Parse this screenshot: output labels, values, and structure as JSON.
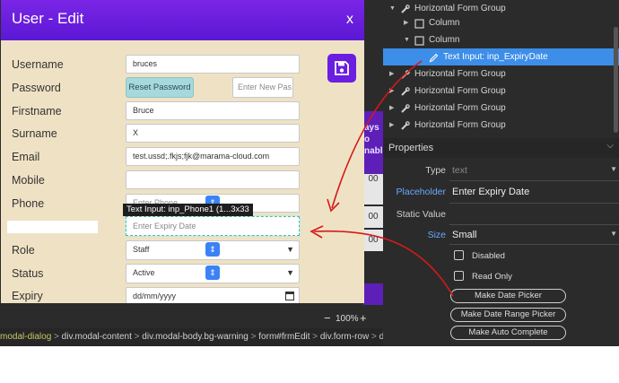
{
  "modal": {
    "title": "User - Edit",
    "close_label": "x",
    "fields": {
      "username_label": "Username",
      "username_value": "bruces",
      "password_label": "Password",
      "reset_password_label": "Reset Password",
      "new_password_placeholder": "Enter New Pas",
      "firstname_label": "Firstname",
      "firstname_value": "Bruce",
      "surname_label": "Surname",
      "surname_value": "X",
      "email_label": "Email",
      "email_value": "test.ussd;.fkjs;fjk@marama-cloud.com",
      "mobile_label": "Mobile",
      "mobile_value": "",
      "phone_label": "Phone",
      "phone_placeholder": "Enter Phone",
      "expiry_placeholder": "Enter Expiry Date",
      "role_label": "Role",
      "role_value": "Staff",
      "status_label": "Status",
      "status_value": "Active",
      "expiry_label": "Expiry",
      "expiry_date_placeholder": "dd/mm/yyyy"
    },
    "tooltip": "Text Input: inp_Phone1 (1...3x33"
  },
  "background": {
    "purple_text_1": "ays",
    "purple_text_2": "o",
    "purple_text_3": "nable",
    "gray_cell_1": "00",
    "gray_cell_2": "00",
    "gray_cell_3": "00"
  },
  "statusbar": {
    "zoom_minus": "−",
    "zoom_value": "100%",
    "zoom_plus": "+"
  },
  "breadcrumb": [
    {
      "text": "modal-dialog",
      "style": "y"
    },
    {
      "text": " > ",
      "style": "g"
    },
    {
      "text": "div.modal-content",
      "style": "w"
    },
    {
      "text": " > ",
      "style": "g"
    },
    {
      "text": "div.modal-body.bg-warning",
      "style": "w"
    },
    {
      "text": " > ",
      "style": "g"
    },
    {
      "text": "form#frmEdit",
      "style": "w"
    },
    {
      "text": " > ",
      "style": "g"
    },
    {
      "text": "div.form-row",
      "style": "w"
    },
    {
      "text": " > ",
      "style": "g"
    },
    {
      "text": "div.c",
      "style": "w"
    }
  ],
  "tree": [
    {
      "label": "Horizontal Form Group",
      "level": 0,
      "expanded": true,
      "selected": false,
      "icon": "wrench"
    },
    {
      "label": "Column",
      "level": 1,
      "expanded": false,
      "selected": false,
      "icon": "box"
    },
    {
      "label": "Column",
      "level": 1,
      "expanded": true,
      "selected": false,
      "icon": "box"
    },
    {
      "label": "Text Input: inp_ExpiryDate",
      "level": 2,
      "expanded": false,
      "selected": true,
      "icon": "pencil"
    },
    {
      "label": "Horizontal Form Group",
      "level": 0,
      "expanded": false,
      "selected": false,
      "icon": "wrench"
    },
    {
      "label": "Horizontal Form Group",
      "level": 0,
      "expanded": false,
      "selected": false,
      "icon": "wrench"
    },
    {
      "label": "Horizontal Form Group",
      "level": 0,
      "expanded": false,
      "selected": false,
      "icon": "wrench"
    },
    {
      "label": "Horizontal Form Group",
      "level": 0,
      "expanded": false,
      "selected": false,
      "icon": "wrench"
    }
  ],
  "properties": {
    "title": "Properties",
    "type_label": "Type",
    "type_value": "text",
    "placeholder_label": "Placeholder",
    "placeholder_value": "Enter Expiry Date",
    "static_value_label": "Static Value",
    "static_value_value": "",
    "size_label": "Size",
    "size_value": "Small",
    "disabled_label": "Disabled",
    "readonly_label": "Read Only",
    "btn_date_picker": "Make Date Picker",
    "btn_date_range_picker": "Make Date Range Picker",
    "btn_auto_complete": "Make Auto Complete"
  },
  "colors": {
    "modal_header": "#6a1ee0",
    "modal_body": "#efe2c4",
    "selection": "#3c8ee8",
    "annotation": "#d41a1a"
  }
}
